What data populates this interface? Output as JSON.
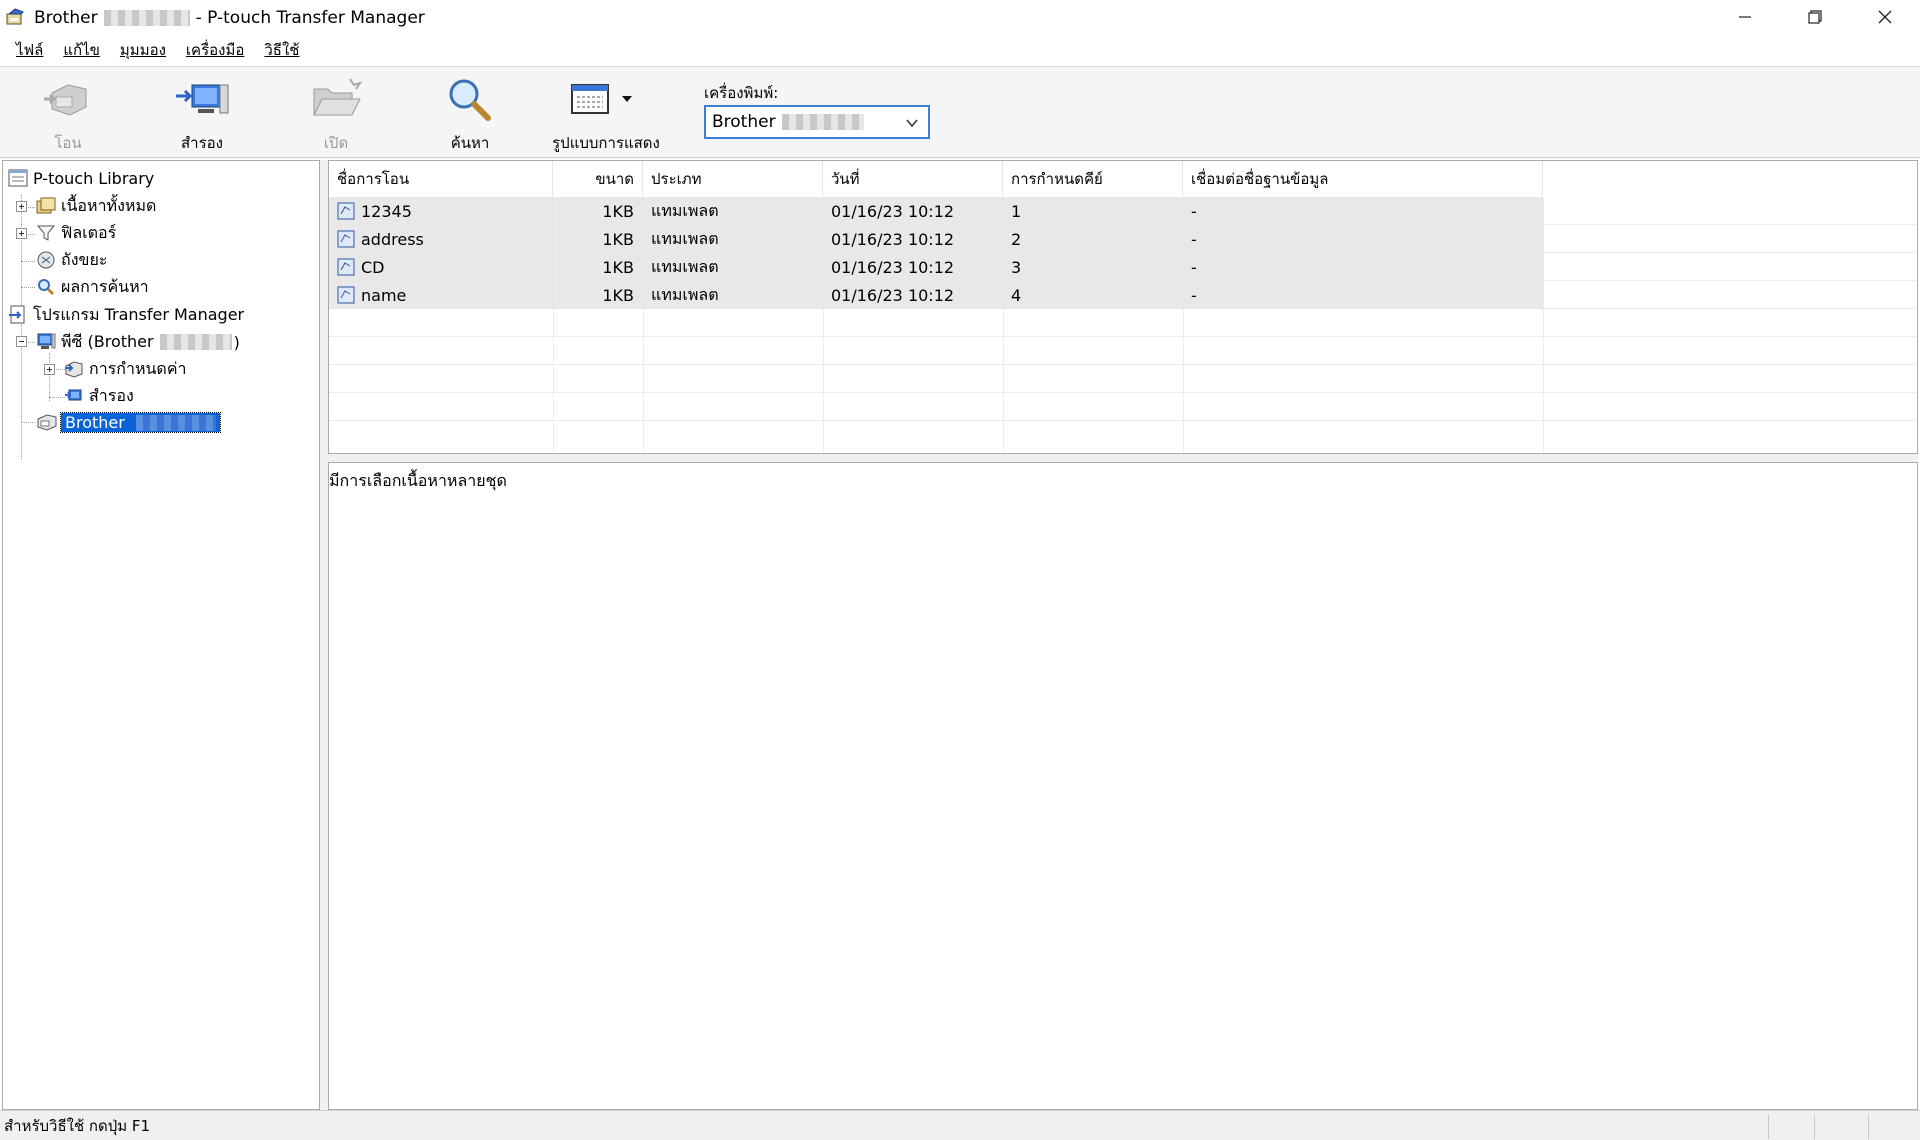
{
  "window": {
    "title_prefix": "Brother",
    "title_suffix": "- P-touch Transfer Manager"
  },
  "menu": [
    "ไฟล์",
    "แก้ไข",
    "มุมมอง",
    "เครื่องมือ",
    "วิธีใช้"
  ],
  "toolbar": {
    "transfer": "โอน",
    "backup": "สำรอง",
    "open": "เปิด",
    "search": "ค้นหา",
    "view_style": "รูปแบบการแสดง",
    "printer_label": "เครื่องพิมพ์:",
    "printer_value": "Brother"
  },
  "tree": {
    "library": "P-touch Library",
    "all_contents": "เนื้อหาทั้งหมด",
    "filter": "ฟิลเตอร์",
    "trash": "ถังขยะ",
    "search_results": "ผลการค้นหา",
    "transfer_manager": "โปรแกรม Transfer Manager",
    "pc": "พีซี (Brother",
    "pc_close": ")",
    "configurations": "การกำหนดค่า",
    "backups": "สำรอง",
    "device": "Brother"
  },
  "table": {
    "columns": [
      "ชื่อการโอน",
      "ขนาด",
      "ประเภท",
      "วันที่",
      "การกำหนดคีย์",
      "เชื่อมต่อชื่อฐานข้อมูล"
    ],
    "rows": [
      {
        "name": "12345",
        "size": "1KB",
        "type": "แทมเพลต",
        "date": "01/16/23 10:12",
        "key": "1",
        "db": "-"
      },
      {
        "name": "address",
        "size": "1KB",
        "type": "แทมเพลต",
        "date": "01/16/23 10:12",
        "key": "2",
        "db": "-"
      },
      {
        "name": "CD",
        "size": "1KB",
        "type": "แทมเพลต",
        "date": "01/16/23 10:12",
        "key": "3",
        "db": "-"
      },
      {
        "name": "name",
        "size": "1KB",
        "type": "แทมเพลต",
        "date": "01/16/23 10:12",
        "key": "4",
        "db": "-"
      }
    ]
  },
  "detail": {
    "message": "มีการเลือกเนื้อหาหลายชุด"
  },
  "status": {
    "help_text": "สำหรับวิธีใช้ กดปุ่ม F1"
  },
  "icons": {
    "app": "brother-app-icon",
    "transfer": "transfer-printer-icon",
    "backup": "backup-computer-icon",
    "open": "open-folder-icon",
    "search": "magnifier-icon",
    "view": "view-style-icon"
  },
  "colors": {
    "selection": "#0a64d8",
    "dropdown_border": "#3c7fd6",
    "row_fill": "#e8e8e8"
  }
}
